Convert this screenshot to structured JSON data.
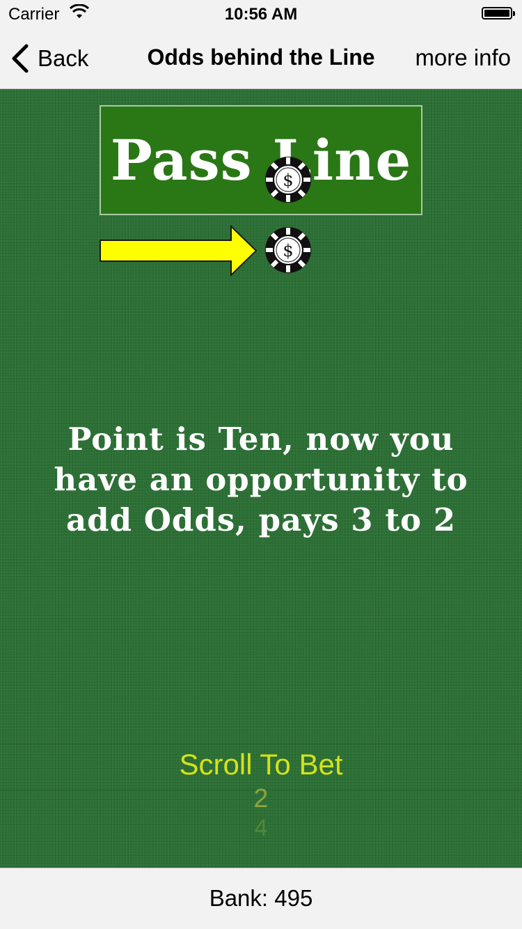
{
  "status_bar": {
    "carrier": "Carrier",
    "time": "10:56 AM",
    "wifi_icon": "wifi-icon",
    "battery_icon": "battery-icon"
  },
  "nav": {
    "back_label": "Back",
    "back_icon": "chevron-left-icon",
    "title": "Odds behind the Line",
    "right_button": "more info"
  },
  "table": {
    "pass_line_label": "Pass Line",
    "chip_symbol": "$",
    "chip_icon": "poker-chip-icon",
    "arrow_icon": "yellow-arrow-right-icon",
    "felt_color": "#2c6f35",
    "pass_line_color": "#2a7716",
    "arrow_color": "#ffff00"
  },
  "message": {
    "line1": "Point is Ten, now you",
    "line2": "have an opportunity to",
    "line3": "add Odds, pays 3 to 2"
  },
  "picker": {
    "selected": "Scroll To Bet",
    "options": [
      "2",
      "4"
    ],
    "accent_color": "#d4e21b"
  },
  "bottom": {
    "bank": "Bank: 495"
  }
}
